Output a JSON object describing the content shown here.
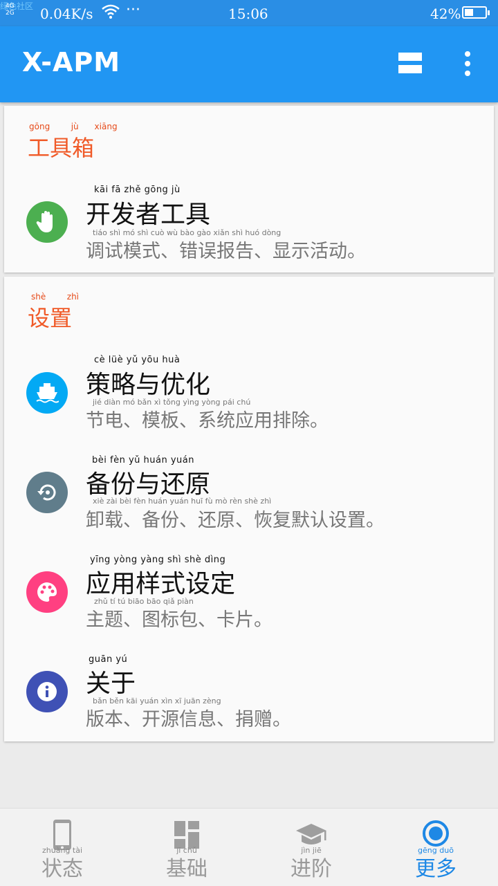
{
  "status_bar": {
    "watermark": "绿色社区",
    "signal": "4G\n2G",
    "network_speed": "0.04K/s",
    "dots": "···",
    "time": "15:06",
    "battery_percent": "42%",
    "battery_level": 0.42
  },
  "app_bar": {
    "title": "X-APM",
    "view_icon": "view-stream-icon",
    "more_icon": "more-vert-icon"
  },
  "sections": [
    {
      "title": "工具箱",
      "title_pinyin": [
        "gōng",
        "jù",
        "xiāng"
      ],
      "items": [
        {
          "title": "开发者工具",
          "title_pinyin": "kāi    fā    zhě  gōng   jù",
          "subtitle": "调试模式、错误报告、显示活动。",
          "subtitle_pinyin": "tiáo    shì    mó    shì          cuò    wù   bào   gào            xiǎn   shì   huó  dòng",
          "icon": "hand-icon",
          "icon_color": "#4caf50"
        }
      ]
    },
    {
      "title": "设置",
      "title_pinyin": [
        "shè",
        "zhì"
      ],
      "items": [
        {
          "title": "策略与优化",
          "title_pinyin": "cè    lüè    yǔ   yōu   huà",
          "subtitle": "节电、模板、系统应用排除。",
          "subtitle_pinyin": "jié   diàn           mó    bǎn           xì    tǒng  yìng  yòng   pái   chú",
          "icon": "ship-icon",
          "icon_color": "#03a9f4"
        },
        {
          "title": "备份与还原",
          "title_pinyin": "bèi    fèn    yǔ   huán  yuán",
          "subtitle": "卸载、备份、还原、恢复默认设置。",
          "subtitle_pinyin": "xiè    zài           bèi    fèn          huán  yuán          huī    fù    mò    rèn   shè    zhì",
          "icon": "restore-icon",
          "icon_color": "#607d8b"
        },
        {
          "title": "应用样式设定",
          "title_pinyin": "yīng  yòng  yàng   shì    shè   dìng",
          "subtitle": "主题、图标包、卡片。",
          "subtitle_pinyin": "zhǔ    tí             tú   biāo   bāo          qiǎ   piàn",
          "icon": "palette-icon",
          "icon_color": "#ff4081"
        },
        {
          "title": "关于",
          "title_pinyin": "guān    yú",
          "subtitle": "版本、开源信息、捐赠。",
          "subtitle_pinyin": "bǎn   běn           kāi  yuán   xìn    xī           juān  zèng",
          "icon": "info-icon",
          "icon_color": "#3f51b5"
        }
      ]
    }
  ],
  "bottom_nav": [
    {
      "label": "状态",
      "pinyin": "zhuàng tài",
      "icon": "phone-icon",
      "active": false
    },
    {
      "label": "基础",
      "pinyin": "jī    chǔ",
      "icon": "dashboard-icon",
      "active": false
    },
    {
      "label": "进阶",
      "pinyin": "jìn    jiē",
      "icon": "school-icon",
      "active": false
    },
    {
      "label": "更多",
      "pinyin": "gēng  duō",
      "icon": "radio-icon",
      "active": true
    }
  ],
  "colors": {
    "status_bar": "#2a8ee5",
    "app_bar": "#2196f3",
    "section_title": "#f05a28",
    "active_tab": "#1e88e5"
  }
}
